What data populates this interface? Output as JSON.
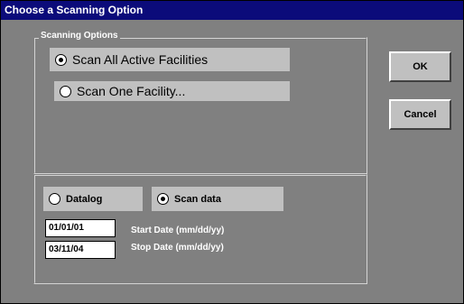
{
  "window": {
    "title": "Choose a Scanning Option"
  },
  "scanning_options": {
    "legend": "Scanning Options",
    "all_label": "Scan All Active Facilities",
    "all_selected": true,
    "one_label": "Scan One Facility...",
    "one_selected": false
  },
  "data_source": {
    "datalog_label": "Datalog",
    "datalog_selected": false,
    "scandata_label": "Scan data",
    "scandata_selected": true
  },
  "dates": {
    "start_value": "01/01/01",
    "start_label": "Start Date (mm/dd/yy)",
    "stop_value": "03/11/04",
    "stop_label": "Stop Date (mm/dd/yy)"
  },
  "buttons": {
    "ok_label": "OK",
    "cancel_label": "Cancel"
  },
  "colors": {
    "title_bar": "#0b0b7a",
    "dialog_bg": "#808080",
    "control_bg": "#c0c0c0"
  }
}
